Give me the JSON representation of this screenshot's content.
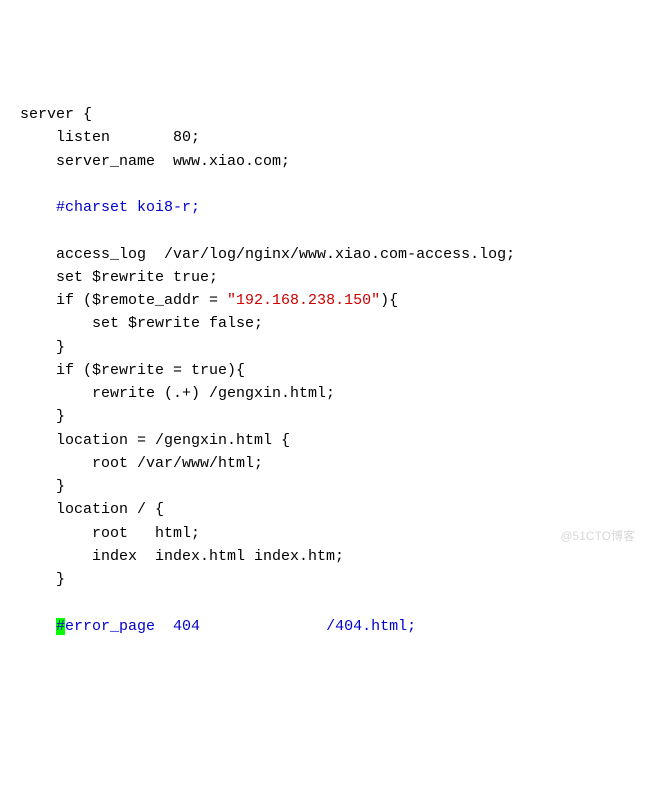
{
  "code": {
    "l1a": "server {",
    "l2a": "    listen       80;",
    "l3a": "    server_name  www.xiao.com;",
    "blank1": "",
    "l4a": "    ",
    "l4b": "#charset koi8-r;",
    "blank2": "",
    "l5a": "    access_log  /var/log/nginx/www.xiao.com-access.log;",
    "l6a": "    set $rewrite true;",
    "l7a": "    if ($remote_addr = ",
    "l7b": "\"192.168.238.150\"",
    "l7c": "){",
    "l8a": "        set $rewrite false;",
    "l9a": "    }",
    "l10a": "    if ($rewrite = true){",
    "l11a": "        rewrite (.+) /gengxin.html;",
    "l12a": "    }",
    "l13a": "    location = /gengxin.html {",
    "l14a": "        root /var/www/html;",
    "l15a": "    }",
    "l16a": "    location / {",
    "l17a": "        root   html;",
    "l18a": "        index  index.html index.htm;",
    "l19a": "    }",
    "blank3": "",
    "l20a": "    ",
    "l20b": "#",
    "l20c": "error_page  404              /404.html;"
  },
  "watermark": "@51CTO博客"
}
